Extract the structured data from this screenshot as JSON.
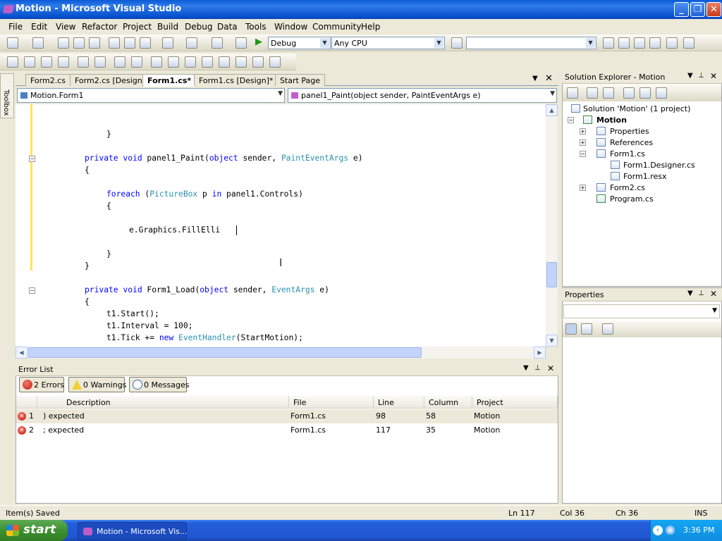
{
  "window": {
    "title": "Motion - Microsoft Visual Studio"
  },
  "menu": [
    "File",
    "Edit",
    "View",
    "Refactor",
    "Project",
    "Build",
    "Debug",
    "Data",
    "Tools",
    "Window",
    "Community",
    "Help"
  ],
  "toolbar": {
    "config": "Debug",
    "platform": "Any CPU",
    "find": ""
  },
  "toolbox_label": "Toolbox",
  "doc_tabs": [
    "Form2.cs",
    "Form2.cs [Design]",
    "Form1.cs*",
    "Form1.cs [Design]*",
    "Start Page"
  ],
  "nav": {
    "class": "Motion.Form1",
    "member": "panel1_Paint(object sender, PaintEventArgs e)"
  },
  "code": {
    "l1": "}",
    "l2_kw": "private void",
    "l2_name": " panel1_Paint(",
    "l2_kw2": "object",
    "l2_mid": " sender, ",
    "l2_type": "PaintEventArgs",
    "l2_end": " e)",
    "l3": "{",
    "l4_kw": "foreach",
    "l4_a": " (",
    "l4_type": "PictureBox",
    "l4_b": " p ",
    "l4_kw2": "in",
    "l4_c": " panel1.Controls)",
    "l5": "{",
    "l6": "e.Graphics.FillElli",
    "l7": "}",
    "l8": "}",
    "l9_kw": "private void",
    "l9_name": " Form1_Load(",
    "l9_kw2": "object",
    "l9_mid": " sender, ",
    "l9_type": "EventArgs",
    "l9_end": " e)",
    "l10": "{",
    "l11": "t1.Start();",
    "l12": "t1.Interval = 100;",
    "l13_a": "t1.Tick += ",
    "l13_kw": "new",
    "l13_b": " ",
    "l13_type": "EventHandler",
    "l13_c": "(StartMotion);"
  },
  "error_list": {
    "title": "Error List",
    "errors_btn": "2 Errors",
    "warnings_btn": "0 Warnings",
    "messages_btn": "0 Messages",
    "columns": [
      "Description",
      "File",
      "Line",
      "Column",
      "Project"
    ],
    "rows": [
      {
        "n": "1",
        "description": ") expected",
        "file": "Form1.cs",
        "line": "98",
        "column": "58",
        "project": "Motion"
      },
      {
        "n": "2",
        "description": "; expected",
        "file": "Form1.cs",
        "line": "117",
        "column": "35",
        "project": "Motion"
      }
    ]
  },
  "solution_explorer": {
    "title": "Solution Explorer - Motion",
    "solution": "Solution 'Motion' (1 project)",
    "project": "Motion",
    "items": [
      "Properties",
      "References",
      "Form1.cs",
      "Form1.Designer.cs",
      "Form1.resx",
      "Form2.cs",
      "Program.cs"
    ]
  },
  "properties": {
    "title": "Properties"
  },
  "status": {
    "message": "Item(s) Saved",
    "ln": "Ln 117",
    "col": "Col 36",
    "ch": "Ch 36",
    "mode": "INS"
  },
  "taskbar": {
    "start": "start",
    "item": "Motion - Microsoft Vis...",
    "time": "3:36 PM"
  }
}
